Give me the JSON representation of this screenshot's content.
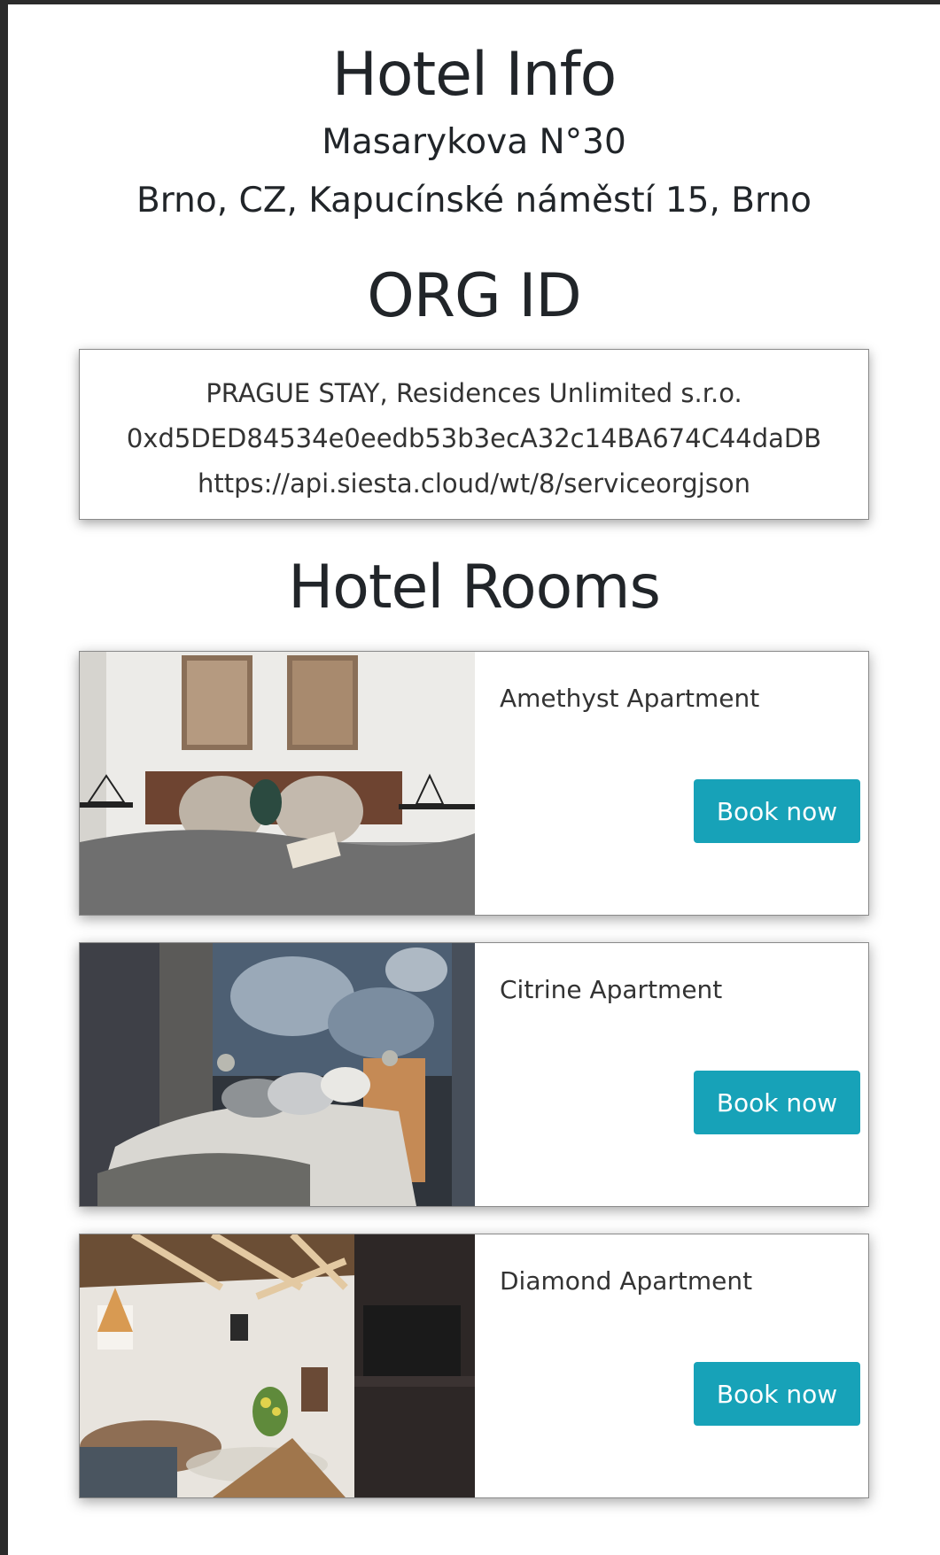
{
  "hotel": {
    "title": "Hotel Info",
    "address_line1": "Masarykova N°30",
    "address_line2": "Brno, CZ, Kapucínské náměstí 15, Brno"
  },
  "org": {
    "title": "ORG ID",
    "name": "PRAGUE STAY, Residences Unlimited s.r.o.",
    "address": "0xd5DED84534e0eedb53b3ecA32c14BA674C44daDB",
    "url": "https://api.siesta.cloud/wt/8/serviceorgjson"
  },
  "rooms_section": {
    "title": "Hotel Rooms",
    "rooms": [
      {
        "name": "Amethyst Apartment",
        "button_label": "Book now"
      },
      {
        "name": "Citrine Apartment",
        "button_label": "Book now"
      },
      {
        "name": "Diamond Apartment",
        "button_label": "Book now"
      }
    ]
  },
  "colors": {
    "button_bg": "#17a2b8",
    "text": "#212529"
  }
}
